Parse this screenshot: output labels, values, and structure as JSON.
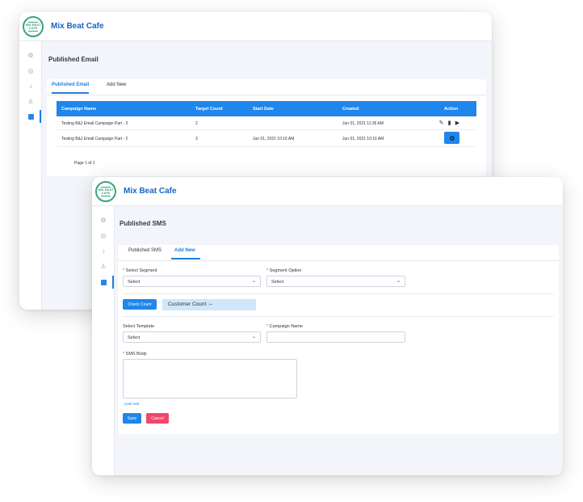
{
  "email_window": {
    "app_name": "Mix Beat Cafe",
    "logo_text": "MIX BEAT CAFE",
    "page_title": "Published Email",
    "tabs": [
      {
        "label": "Published Email",
        "active": true
      },
      {
        "label": "Add New",
        "active": false
      }
    ],
    "table": {
      "headers": [
        "Campaign Name",
        "Target Count",
        "Start Date",
        "Created",
        "Action"
      ],
      "rows": [
        {
          "campaign_name": "Testing B&J Email Campaign Part - 3",
          "target_count": "2",
          "start_date": "",
          "created": "Jun 01, 2021 11:36 AM",
          "actions": [
            "edit-icon",
            "delete-icon",
            "play-icon"
          ]
        },
        {
          "campaign_name": "Testing B&J Email Campaign Part - 2",
          "target_count": "3",
          "start_date": "Jun 01, 2021 10:16 AM",
          "created": "Jun 01, 2021 10:16 AM",
          "actions": [
            "running-gear-icon"
          ]
        }
      ]
    },
    "pagination": "Page 1 of 1",
    "sidebar_icons": [
      "gear-icon",
      "contact-icon",
      "bell-icon",
      "user-icon",
      "campaign-icon"
    ]
  },
  "sms_window": {
    "app_name": "Mix Beat Cafe",
    "logo_text": "MIX BEAT CAFE",
    "page_title": "Published SMS",
    "tabs": [
      {
        "label": "Published SMS",
        "active": false
      },
      {
        "label": "Add New",
        "active": true
      }
    ],
    "form": {
      "select_segment": {
        "label": "Select Segment",
        "required": true,
        "value": "Select"
      },
      "segment_option": {
        "label": "Segment Option",
        "required": true,
        "value": "Select"
      },
      "check_count_button": "Check Count",
      "customer_count": "Customer Count :--",
      "select_template": {
        "label": "Select Template",
        "required": false,
        "value": "Select"
      },
      "campaign_name": {
        "label": "Campaign Name",
        "required": true,
        "value": ""
      },
      "sms_body": {
        "label": "SMS Body",
        "required": true,
        "value": ""
      },
      "limit_text": "Limit:160",
      "save_button": "Save",
      "cancel_button": "Cancel"
    },
    "sidebar_icons": [
      "gear-icon",
      "contact-icon",
      "bell-icon",
      "user-icon",
      "campaign-icon"
    ]
  },
  "colors": {
    "accent": "#1f86ec",
    "brand_text": "#1665c8",
    "danger": "#f0476a",
    "logo_green": "#3aa37a",
    "count_box": "#cfe6fb"
  }
}
